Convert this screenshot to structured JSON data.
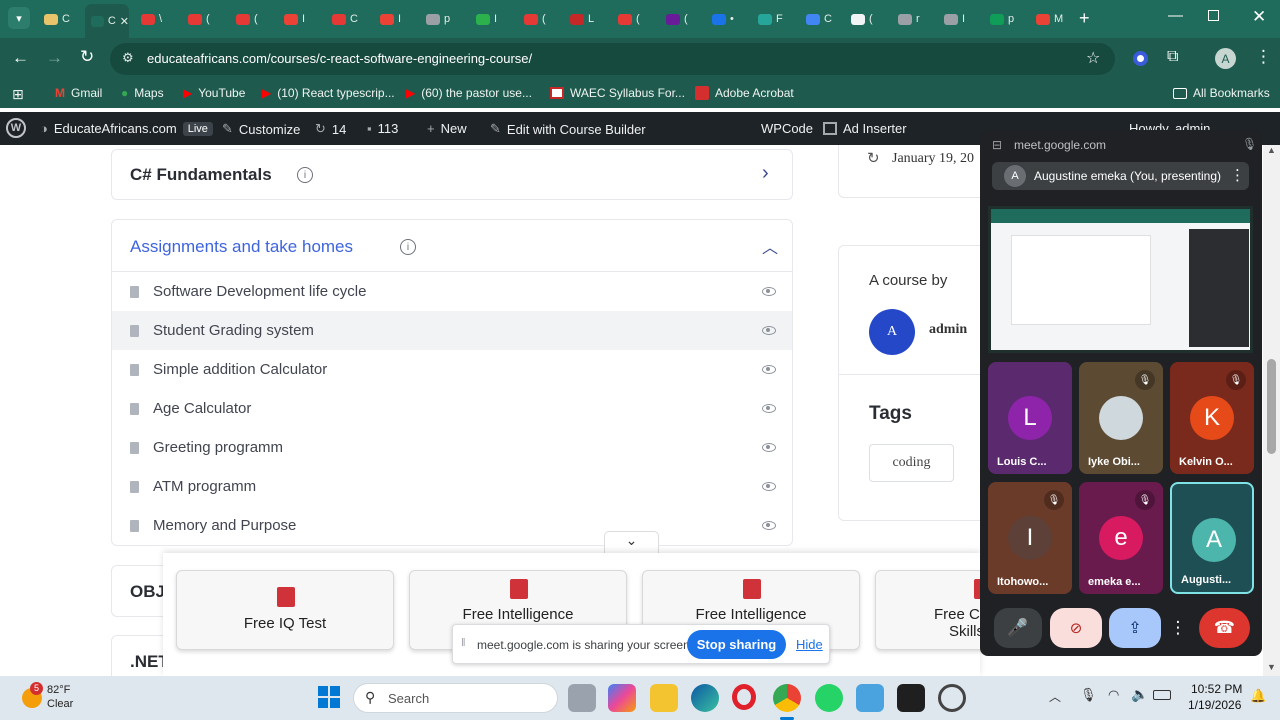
{
  "browser": {
    "url": "educateafricans.com/courses/c-react-software-engineering-course/",
    "tabs": [
      {
        "label": "C",
        "color": "#e9c46a"
      },
      {
        "label": "C",
        "color": "#1f6b5c",
        "active": true
      },
      {
        "label": "\\",
        "color": "#e53935"
      },
      {
        "label": "(",
        "color": "#e53935"
      },
      {
        "label": "(",
        "color": "#e53935"
      },
      {
        "label": "I",
        "color": "#ea4335"
      },
      {
        "label": "C",
        "color": "#e53935"
      },
      {
        "label": "I",
        "color": "#ea4335"
      },
      {
        "label": "p",
        "color": "#9aa0a6"
      },
      {
        "label": "I",
        "color": "#2bb24c"
      },
      {
        "label": "(",
        "color": "#e53935"
      },
      {
        "label": "L",
        "color": "#c62828"
      },
      {
        "label": "(",
        "color": "#e53935"
      },
      {
        "label": "(",
        "color": "#6a1b9a"
      },
      {
        "label": "•",
        "color": "#1a73e8"
      },
      {
        "label": "F",
        "color": "#26a69a"
      },
      {
        "label": "C",
        "color": "#4285f4"
      },
      {
        "label": "(",
        "color": "#f1f3f4"
      },
      {
        "label": "r",
        "color": "#9aa0a6"
      },
      {
        "label": "I",
        "color": "#9aa0a6"
      },
      {
        "label": "p",
        "color": "#0f9d58"
      },
      {
        "label": "M",
        "color": "#ea4335"
      }
    ],
    "bookmarks": [
      "Gmail",
      "Maps",
      "YouTube",
      "(10) React typescrip...",
      "(60) the pastor use...",
      "WAEC Syllabus For...",
      "Adobe Acrobat"
    ],
    "all_bookmarks": "All Bookmarks",
    "profile_initial": "A"
  },
  "wp_admin": {
    "site": "EducateAfricans.com",
    "live": "Live",
    "customize": "Customize",
    "updates": "14",
    "comments": "113",
    "new": "New",
    "edit_builder": "Edit with Course Builder",
    "wpcode": "WPCode",
    "ad_inserter": "Ad Inserter",
    "howdy": "Howdy, admin"
  },
  "course": {
    "section_closed": "C# Fundamentals",
    "section_open": "Assignments and take homes",
    "lessons": [
      "Software Development life cycle",
      "Student Grading system",
      "Simple addition Calculator",
      "Age Calculator",
      "Greeting programm",
      "ATM programm",
      "Memory and Purpose"
    ],
    "next_section_1": "OBJ",
    "next_section_2": ".NET"
  },
  "sidebar": {
    "date": "January 19, 20",
    "course_by": "A course by",
    "author_initial": "A",
    "author": "admin",
    "tags_title": "Tags",
    "tag": "coding"
  },
  "promos": [
    "Free IQ Test",
    "Free Intelligence",
    "Free Intelligence",
    "Free C",
    "Skills"
  ],
  "share_bar": {
    "text": "meet.google.com is sharing your screen.",
    "stop": "Stop sharing",
    "hide": "Hide"
  },
  "meet": {
    "origin": "meet.google.com",
    "presenter_initial": "A",
    "presenter": "Augustine emeka (You, presenting)",
    "participants": [
      {
        "initial": "L",
        "name": "Louis C...",
        "bg": "#5b2a6e",
        "avatar": "#8e24aa",
        "muted": false
      },
      {
        "initial": "",
        "name": "Iyke Obi...",
        "bg": "#5d4a33",
        "avatar": "#cfd8dc",
        "muted": true
      },
      {
        "initial": "K",
        "name": "Kelvin O...",
        "bg": "#7a2a1c",
        "avatar": "#e64a19",
        "muted": true
      },
      {
        "initial": "I",
        "name": "Itohowo...",
        "bg": "#6b3b2a",
        "avatar": "#5d4037",
        "muted": true
      },
      {
        "initial": "e",
        "name": "emeka e...",
        "bg": "#6a1b4d",
        "avatar": "#d81b60",
        "muted": true
      },
      {
        "initial": "A",
        "name": "Augusti...",
        "bg": "#1e4f55",
        "avatar": "#4db6ac",
        "muted": false
      }
    ]
  },
  "taskbar": {
    "weather_temp": "82°F",
    "weather_cond": "Clear",
    "weather_badge": "5",
    "search": "Search",
    "time": "10:52 PM",
    "date": "1/19/2026"
  }
}
